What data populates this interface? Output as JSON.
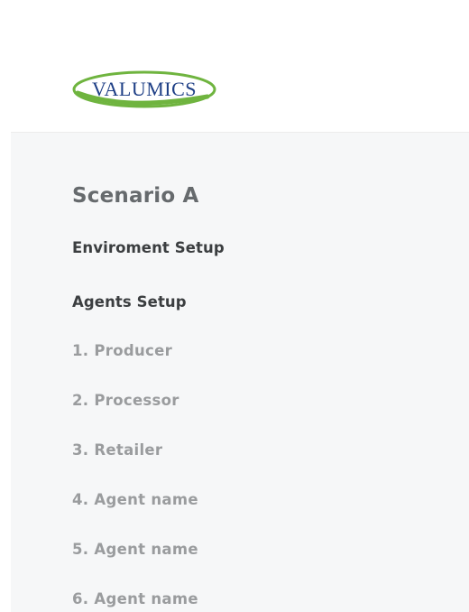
{
  "logo": {
    "text": "VALUMICS",
    "ring_color": "#6fb43f",
    "text_color": "#1e3f86"
  },
  "nav": {
    "scenario_title": "Scenario A",
    "environment_setup_label": "Enviroment Setup",
    "agents_setup_label": "Agents Setup",
    "agents": [
      "1. Producer",
      "2. Processor",
      "3. Retailer",
      "4. Agent name",
      "5. Agent name",
      "6. Agent name"
    ]
  }
}
